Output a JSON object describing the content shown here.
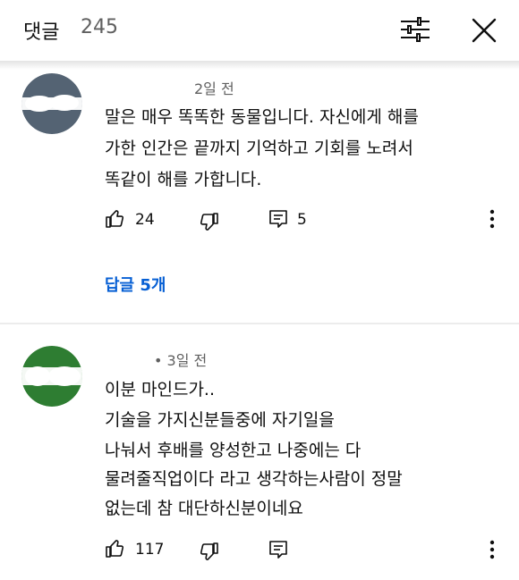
{
  "header": {
    "title": "댓글",
    "count": "245",
    "filter_icon": "sort-filter-icon",
    "close_icon": "close-icon"
  },
  "comments": [
    {
      "time": "2일 전",
      "lines": [
        "말은 매우 똑똑한 동물입니다. 자신에게 해를",
        "가한 인간은 끝까지 기억하고 기회를 노려서",
        "똑같이 해를 가합니다."
      ],
      "likes": "24",
      "reply_count": "5",
      "replies_link": "답글 5개",
      "avatar_color": "#546373"
    },
    {
      "time": "• 3일 전",
      "lines": [
        "이분 마인드가..",
        "기술을 가지신분들중에 자기일을",
        "나눠서 후배를 양성한고 나중에는 다",
        "물려줄직업이다 라고 생각하는사람이 정말",
        "없는데 참 대단하신분이네요"
      ],
      "likes": "117",
      "reply_count": "",
      "avatar_color": "#2e7d32"
    }
  ],
  "colors": {
    "link_blue": "#065fd4",
    "secondary_text": "#606060"
  }
}
